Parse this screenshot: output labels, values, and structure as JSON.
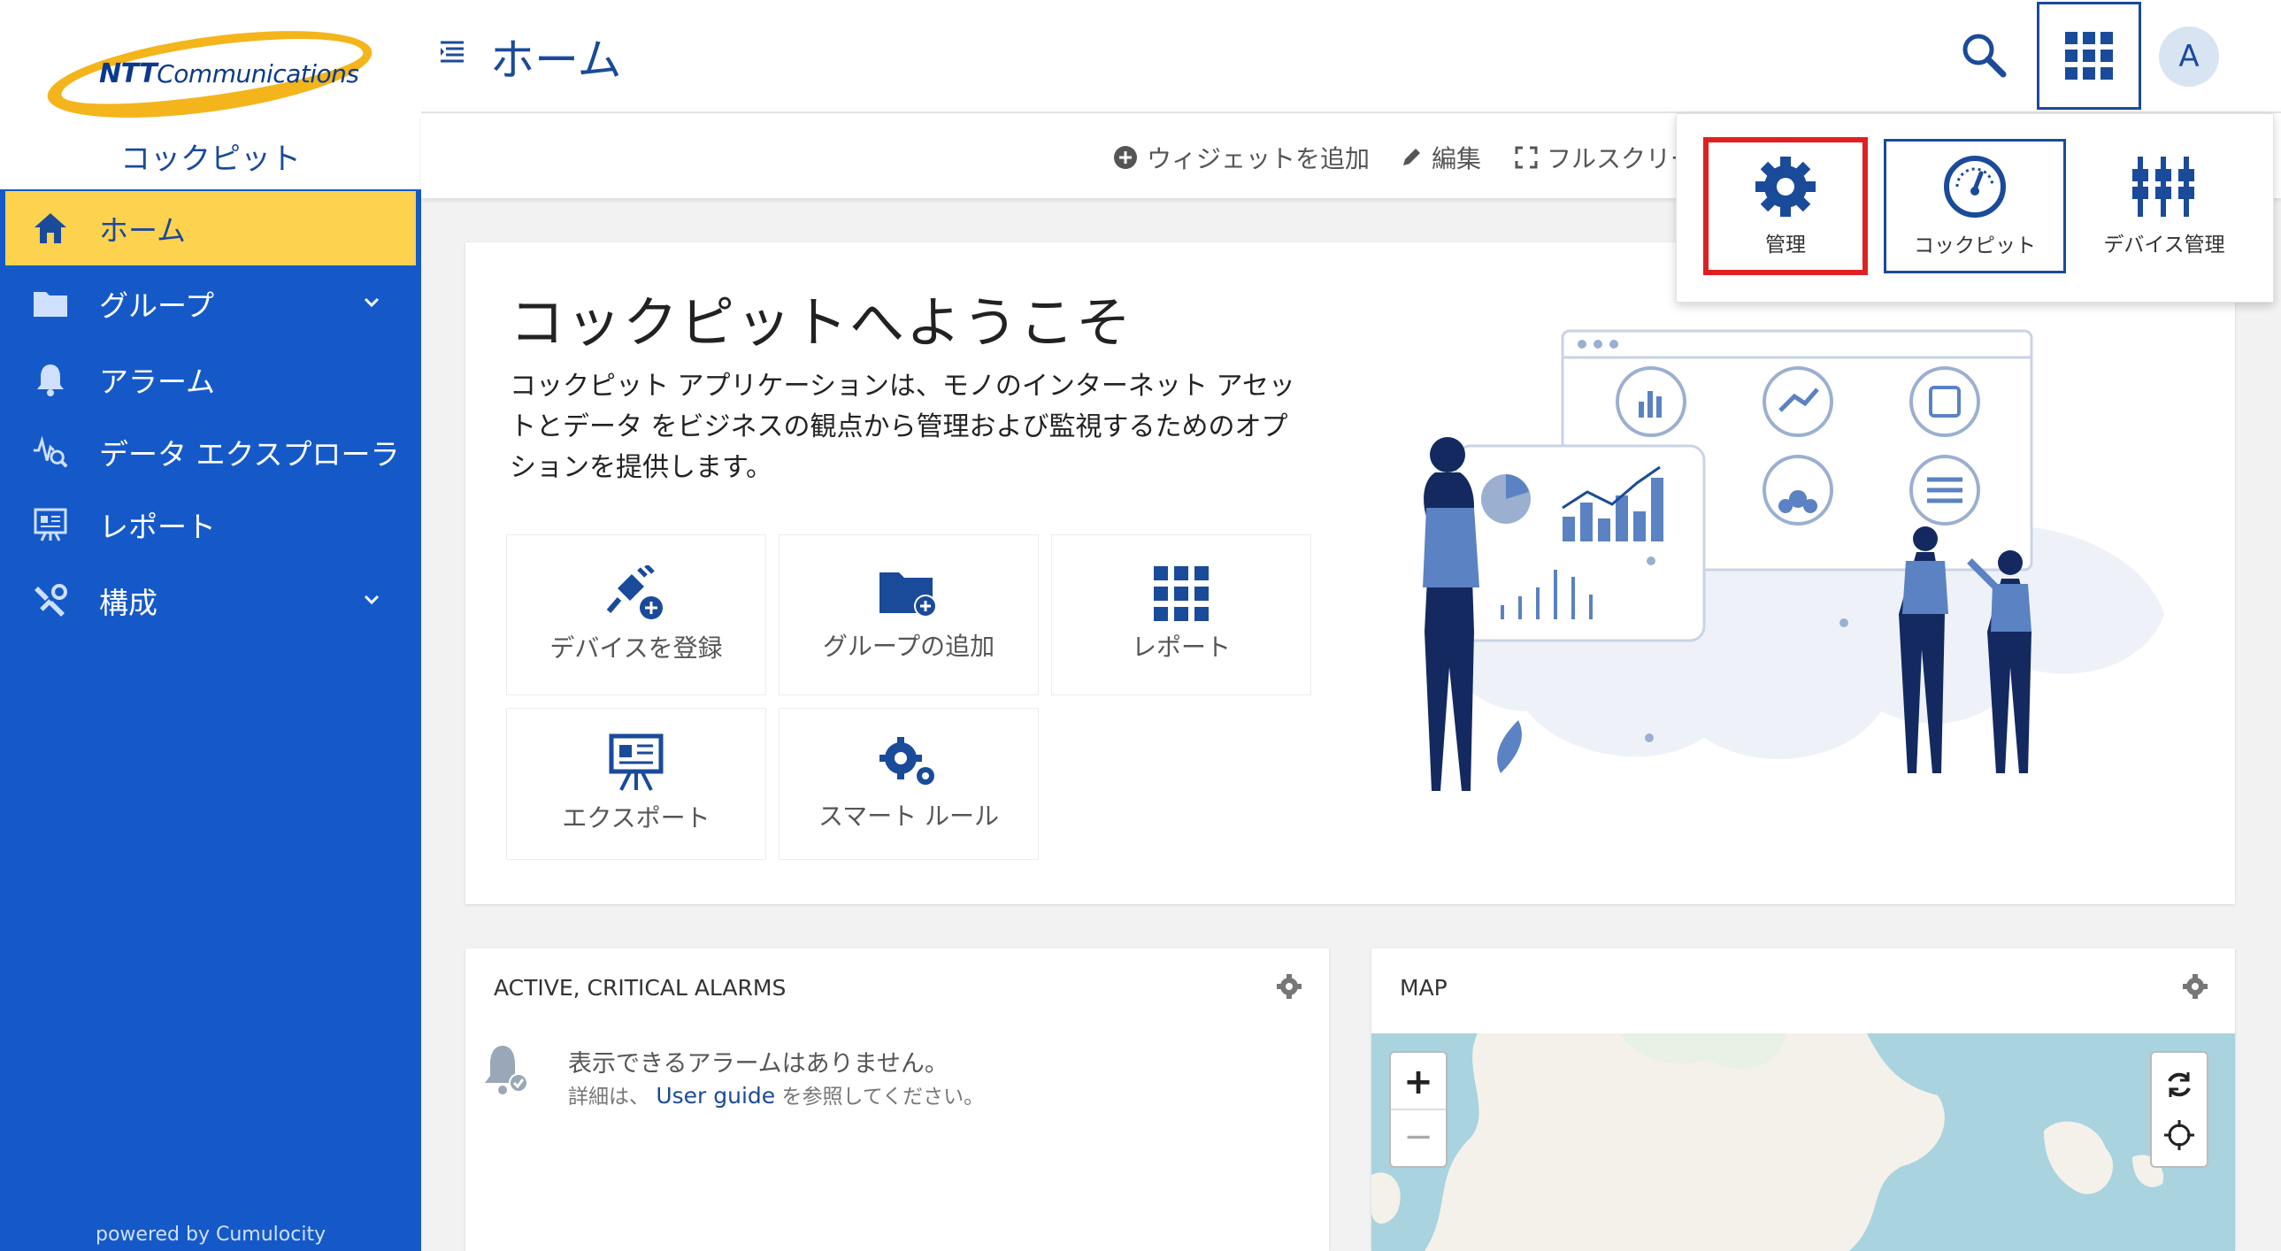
{
  "sidebar": {
    "brand_main": "NTT",
    "brand_sub": "Communications",
    "app_name": "コックピット",
    "items": [
      {
        "label": "ホーム"
      },
      {
        "label": "グループ"
      },
      {
        "label": "アラーム"
      },
      {
        "label": "データ エクスプローラ"
      },
      {
        "label": "レポート"
      },
      {
        "label": "構成"
      }
    ],
    "powered_by": "powered by Cumulocity"
  },
  "header": {
    "title": "ホーム",
    "avatar_initial": "A"
  },
  "toolbar": {
    "add_widget": "ウィジェットを追加",
    "edit": "編集",
    "fullscreen": "フルスクリーン"
  },
  "welcome": {
    "title": "コックピットへようこそ",
    "description": "コックピット アプリケーションは、モノのインターネット アセットとデータ をビジネスの観点から管理および監視するためのオプションを提供します。",
    "tiles": [
      {
        "label": "デバイスを登録"
      },
      {
        "label": "グループの追加"
      },
      {
        "label": "レポート"
      },
      {
        "label": "エクスポート"
      },
      {
        "label": "スマート ルール"
      }
    ]
  },
  "alarms_widget": {
    "title": "ACTIVE, CRITICAL ALARMS",
    "empty": "表示できるアラームはありません。",
    "detail_prefix": "詳細は、",
    "link": "User guide",
    "detail_suffix": "を参照してください。"
  },
  "map_widget": {
    "title": "MAP",
    "zoom_in": "+",
    "zoom_out": "−"
  },
  "app_switcher": {
    "apps": [
      {
        "label": "管理",
        "highlighted": true
      },
      {
        "label": "コックピット",
        "current": true
      },
      {
        "label": "デバイス管理"
      }
    ]
  },
  "colors": {
    "primary": "#1559c9",
    "accent": "#fdd24f",
    "highlight": "#e02020",
    "text_blue": "#1a4a9a"
  }
}
